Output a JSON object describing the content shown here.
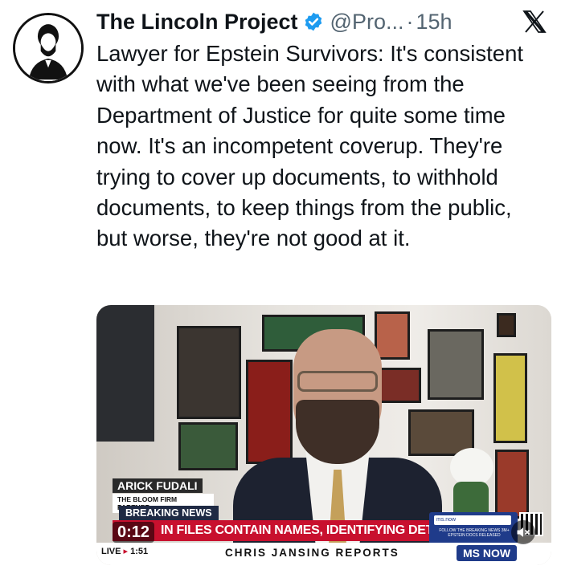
{
  "tweet": {
    "author_name": "The Lincoln Project",
    "verified_icon": "verified-badge-icon",
    "handle": "@Pro...",
    "separator": "·",
    "time": "15h",
    "close_icon": "x-close-icon",
    "text": "Lawyer for Epstein Survivors: It's consistent with what we've been seeing from the Department of Justice for quite some time now. It's an incompetent coverup. They're trying to cover up documents, to withhold documents, to keep things from the public, but worse, they're not good at it."
  },
  "video": {
    "duration": "0:12",
    "lower_third": {
      "name": "ARICK FUDALI",
      "title": "THE BLOOM FIRM PARTNER",
      "breaking": "BREAKING NEWS",
      "headline": "IN FILES CONTAIN NAMES, IDENTIFYING DETAILS OF SURVIVORS",
      "live": "LIVE",
      "live_time": "1:51",
      "show": "CHRIS JANSING REPORTS",
      "site": "ms.now",
      "promo": "FOLLOW THE BREAKING NEWS 3M+ EPSTEIN DOCS RELEASED",
      "network": "MS NOW"
    },
    "mute_icon": "speaker-mute-icon"
  },
  "colors": {
    "accent_blue": "#1d9bf0",
    "text_primary": "#0f1419",
    "text_secondary": "#536471",
    "ticker_red": "#c8102e",
    "network_blue": "#1f3b8a"
  }
}
